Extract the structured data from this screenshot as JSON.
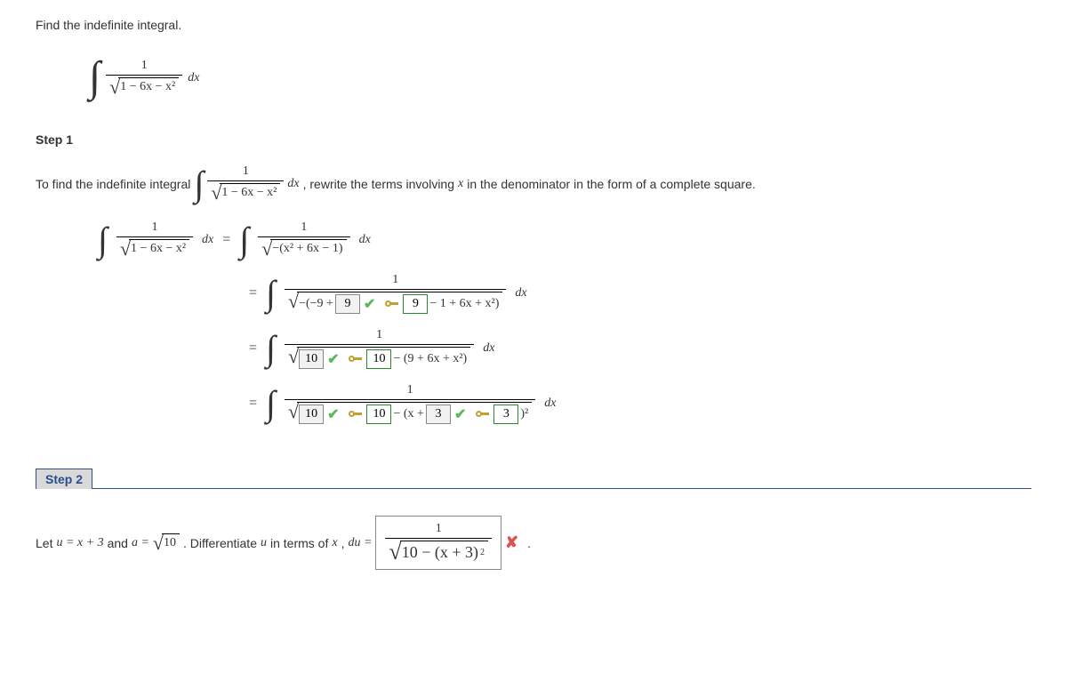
{
  "prompt": "Find the indefinite integral.",
  "step1": {
    "label": "Step 1",
    "intro_a": "To find the indefinite integral ",
    "intro_b": ", rewrite the terms involving ",
    "intro_var": "x",
    "intro_c": " in the denominator in the form of a complete square.",
    "line2_den": "−(x² + 6x − 1)",
    "line3_left": "−(−9 +",
    "line3_right": " − 1 + 6x + x²)",
    "line4_right": " − (9 + 6x + x²)",
    "line5_mid": " − (x + ",
    "line5_end": " )²",
    "answers": {
      "a1": "9",
      "a2": "9",
      "a3": "10",
      "a4": "10",
      "a5": "10",
      "a6": "10",
      "a7": "3",
      "a8": "3"
    }
  },
  "step2": {
    "label": "Step 2",
    "text_a": "Let ",
    "text_u": "u = x + 3",
    "text_b": " and ",
    "text_a_eq": "a = ",
    "sqrt10": "10",
    "text_c": ". Differentiate ",
    "text_u2": "u",
    "text_d": " in terms of ",
    "text_x": "x",
    "text_e": ", ",
    "text_du": "du = ",
    "du_numer": "1",
    "du_rad": "10 − (x + 3)",
    "du_sup": "2"
  },
  "common": {
    "one": "1",
    "dx": "dx",
    "den1": "1 − 6x − x²"
  }
}
